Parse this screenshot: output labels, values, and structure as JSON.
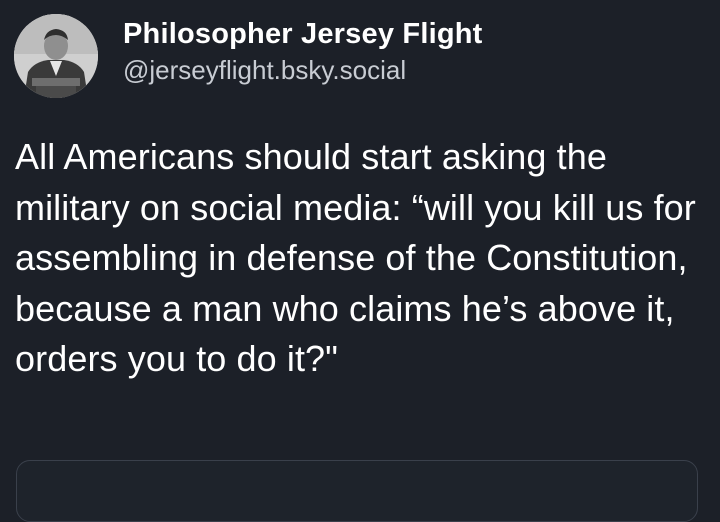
{
  "author": {
    "display_name": "Philosopher Jersey Flight",
    "handle": "@jerseyflight.bsky.social",
    "avatar_icon": "avatar-portrait"
  },
  "post": {
    "text": "All Americans should start asking the military on social media: “will you kill us for assembling in defense of the Constitution, because a man who claims he’s above it, orders you to do it?\""
  },
  "colors": {
    "background": "#1c2028",
    "name_text": "#ffffff",
    "handle_text": "#c8ccd3",
    "card_border": "#3a404b"
  }
}
